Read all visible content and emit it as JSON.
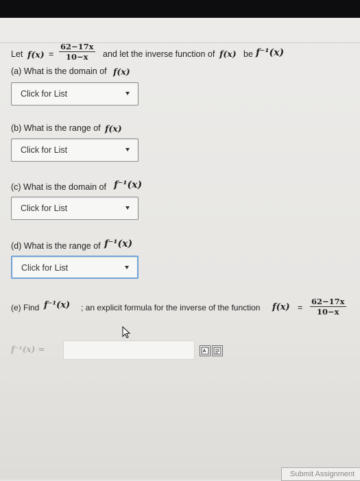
{
  "header": {
    "let": "Let",
    "f_of_x": "f(x)",
    "equals": "=",
    "numerator": "62−17x",
    "denominator": "10−x",
    "mid_text": "and let the inverse function of",
    "f_of_x_2": "f(x)",
    "be": "be",
    "f_inverse": "f⁻¹(x)"
  },
  "parts": {
    "a": {
      "question": "(a) What is the domain of",
      "expr": "f(x)",
      "select": "Click for List"
    },
    "b": {
      "question": "(b) What is the range of",
      "expr": "f(x)",
      "select": "Click for List"
    },
    "c": {
      "question": "(c) What is the domain of",
      "expr": "f⁻¹(x)",
      "select": "Click for List"
    },
    "d": {
      "question": "(d) What is the range of",
      "expr": "f⁻¹(x)",
      "select": "Click for List"
    },
    "e": {
      "prefix": "(e) Find",
      "expr": "f⁻¹(x)",
      "middle": "; an explicit formula for the inverse of the function",
      "f_of_x": "f(x)",
      "equals": "=",
      "numerator": "62−17x",
      "denominator": "10−x",
      "answer_label": "f⁻¹(x) =",
      "answer_value": ""
    }
  },
  "footer": {
    "submit_label": "Submit Assignment"
  },
  "icons": [
    "cursor-arrow-icon",
    "formula-editor-icon",
    "preview-icon",
    "dropdown-caret-icon"
  ]
}
